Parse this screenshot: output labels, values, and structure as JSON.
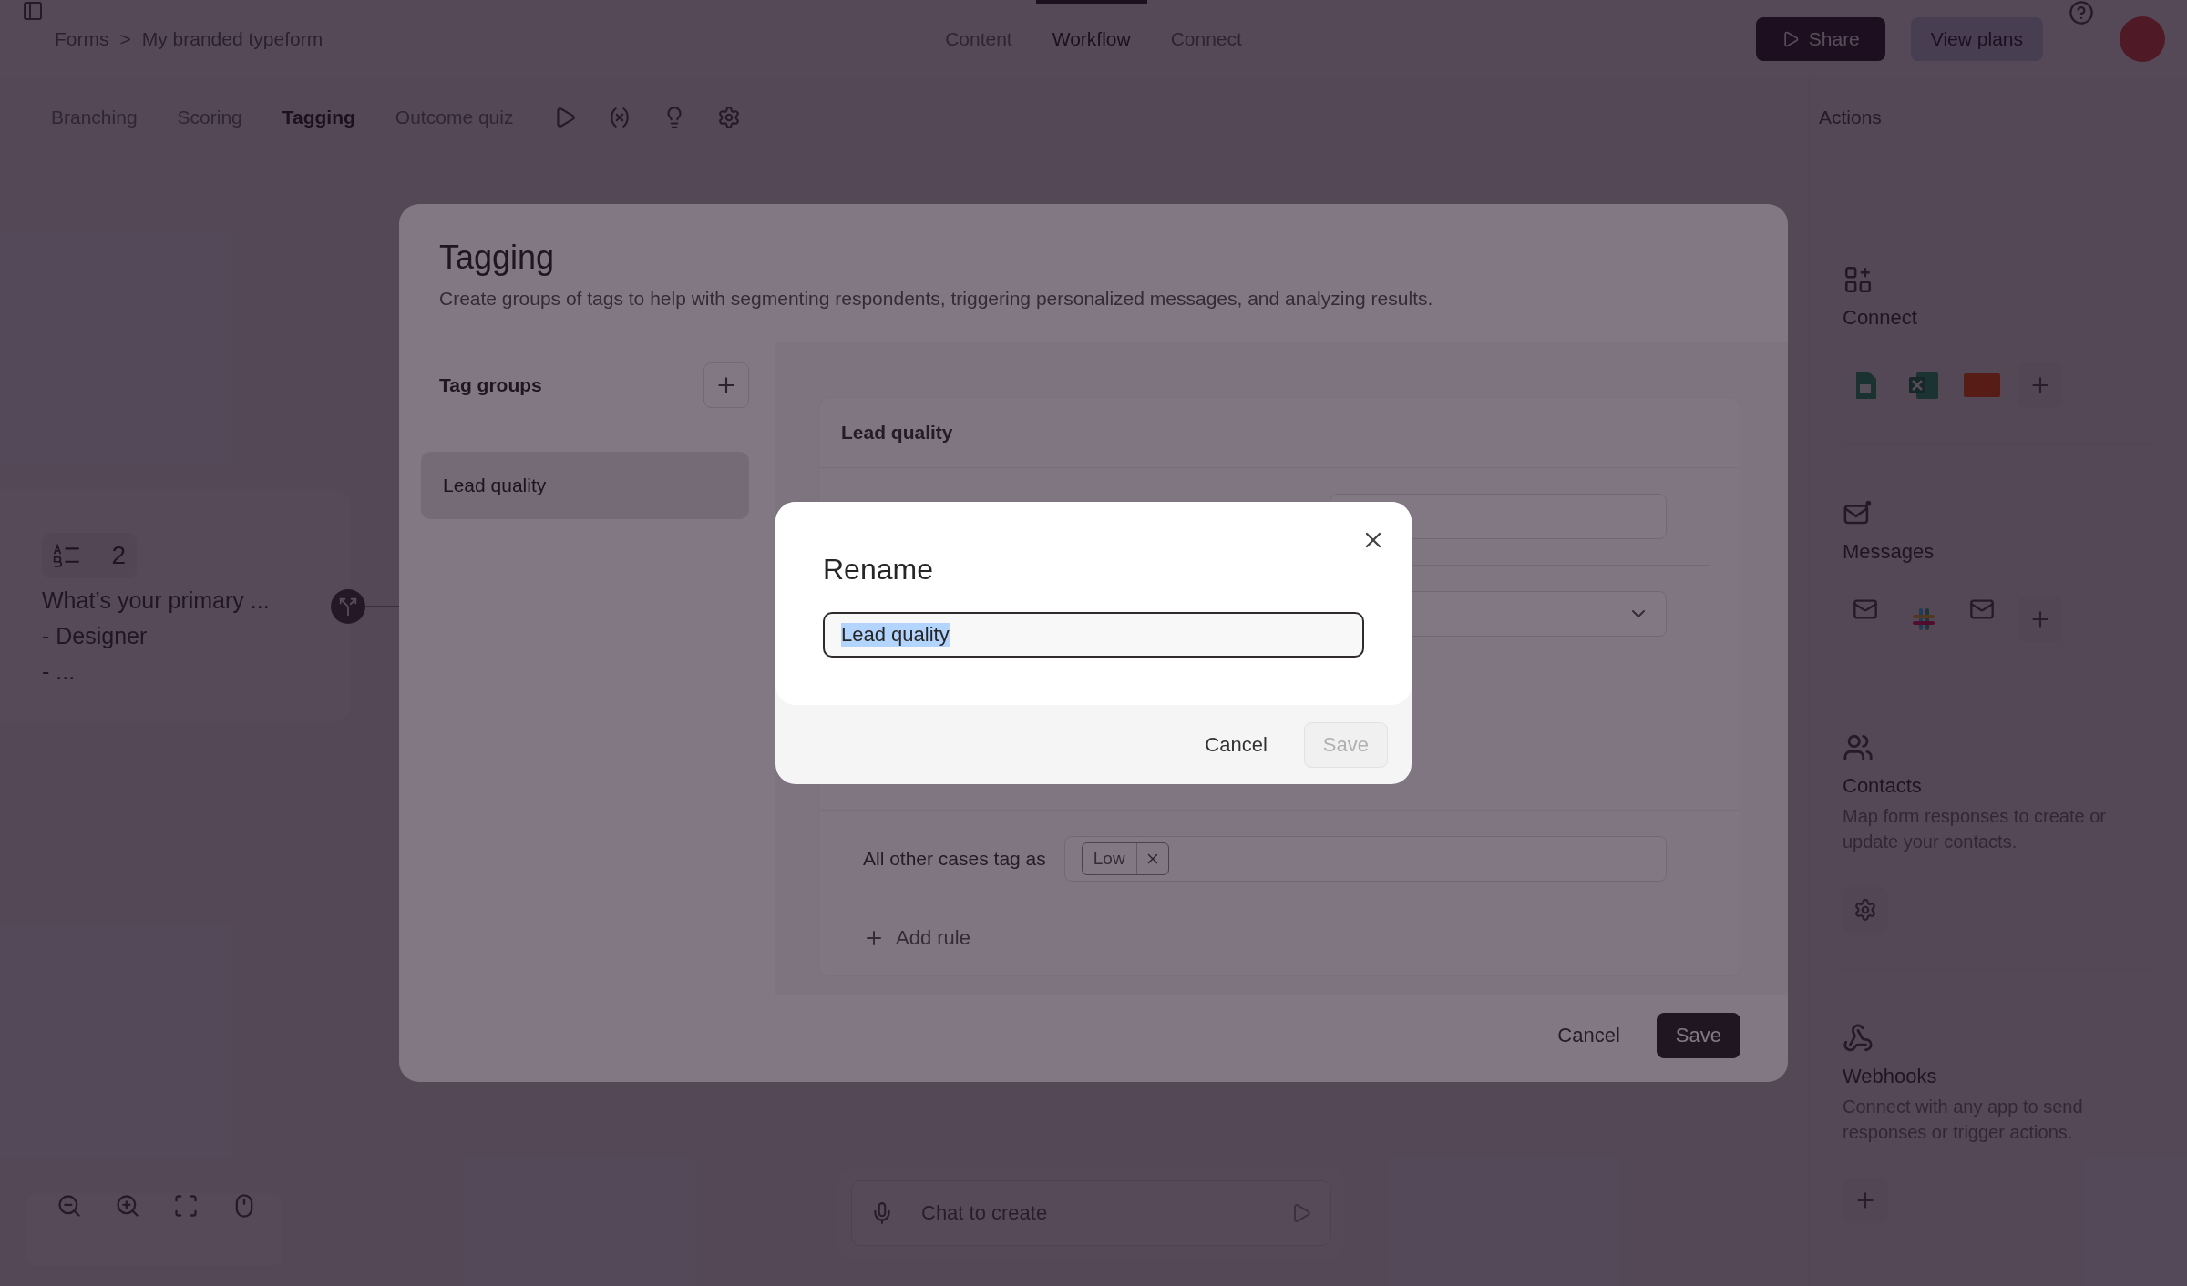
{
  "topbar": {
    "breadcrumb": [
      "Forms",
      "My branded typeform"
    ],
    "separator": ">",
    "tabs": [
      {
        "label": "Content",
        "selected": false
      },
      {
        "label": "Workflow",
        "selected": true
      },
      {
        "label": "Connect",
        "selected": false
      }
    ],
    "share": "Share",
    "view_plans": "View plans"
  },
  "subbar": {
    "tabs": [
      {
        "label": "Branching",
        "selected": false
      },
      {
        "label": "Scoring",
        "selected": false
      },
      {
        "label": "Tagging",
        "selected": true
      },
      {
        "label": "Outcome quiz",
        "selected": false
      }
    ],
    "actions_title": "Actions"
  },
  "canvas": {
    "node": {
      "badge": "2",
      "title": "What’s your primary ...",
      "lines": [
        "- Designer",
        "- ..."
      ]
    },
    "chat": {
      "placeholder": "Chat to create"
    }
  },
  "actions": [
    {
      "kind": "connect",
      "title": "Connect"
    },
    {
      "kind": "messages",
      "title": "Messages"
    },
    {
      "kind": "contacts",
      "title": "Contacts",
      "description": "Map form responses to create or update your contacts."
    },
    {
      "kind": "webhooks",
      "title": "Webhooks",
      "description": "Connect with any app to send responses or trigger actions."
    }
  ],
  "tagging": {
    "title": "Tagging",
    "description": "Create groups of tags to help with segmenting respondents, triggering personalized messages, and analyzing results.",
    "groups_title": "Tag groups",
    "groups": [
      {
        "label": "Lead quality",
        "selected": true
      }
    ],
    "group_title": "Lead quality",
    "fallback_label": "All other cases tag as",
    "fallback_tags": [
      "Low"
    ],
    "add_rule": "Add rule",
    "cancel": "Cancel",
    "save": "Save"
  },
  "rename": {
    "title": "Rename",
    "value": "Lead quality",
    "value_selected": true,
    "cancel": "Cancel",
    "save": "Save",
    "save_disabled": true
  }
}
